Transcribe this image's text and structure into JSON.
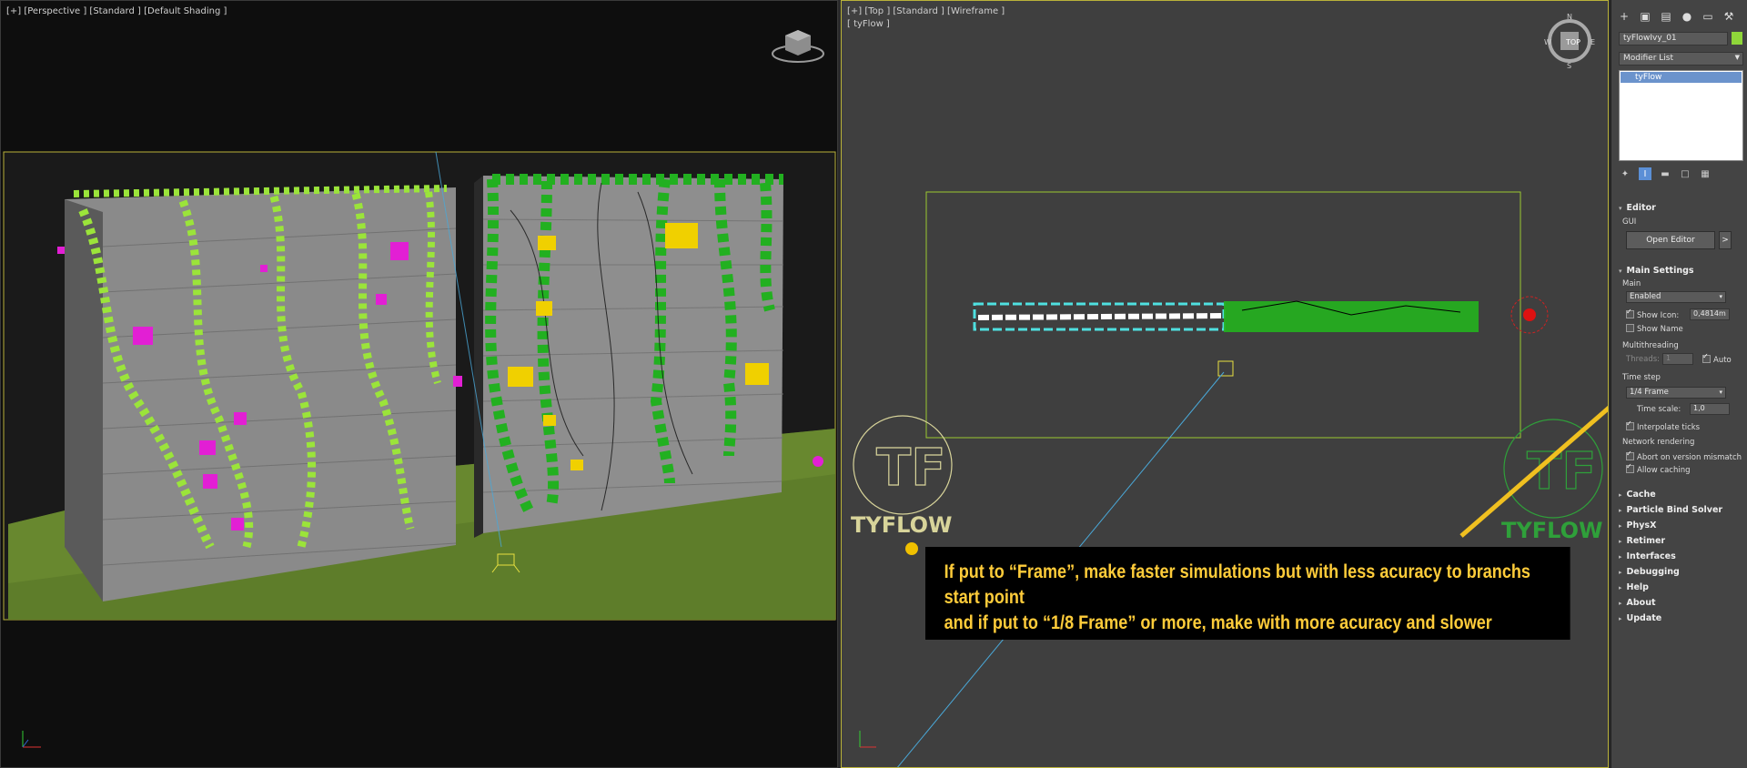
{
  "viewports": {
    "left": {
      "label": "[+] [Perspective ] [Standard ] [Default Shading ]"
    },
    "right": {
      "label": "[+] [Top ] [Standard ] [Wireframe ]",
      "sublabel": "[ tyFlow ]"
    }
  },
  "logo": {
    "text": "TYFLOW",
    "mark": "TF"
  },
  "viewcube": {
    "north": "N",
    "south": "S",
    "east": "E",
    "west": "W"
  },
  "annotation": {
    "line1": "If put to  “Frame”, make faster simulations but with less acuracy to branchs start point",
    "line2": "and if put to “1/8 Frame” or more, make with more acuracy and slower"
  },
  "colors": {
    "accent": "#a6d23a",
    "highlight": "#ffcc3a",
    "selection": "#6b93cc"
  },
  "panel": {
    "toolbar_icons": [
      "create-icon",
      "modify-icon",
      "hierarchy-icon",
      "motion-icon",
      "display-icon",
      "utilities-icon"
    ],
    "object_name": "tyFlowIvy_01",
    "modifier_list": "Modifier List",
    "stack_item": "tyFlow",
    "editor": {
      "title": "Editor",
      "gui": "GUI",
      "open_editor": "Open Editor",
      "arrow": ">"
    },
    "main_settings": {
      "title": "Main Settings",
      "main": "Main",
      "enabled": "Enabled",
      "show_icon": "Show Icon:",
      "icon_size": "0,4814m",
      "show_name": "Show Name",
      "multithreading": "Multithreading",
      "threads": "Threads:",
      "threads_value": "1",
      "auto": "Auto",
      "time_step": "Time step",
      "time_step_value": "1/4 Frame",
      "time_scale": "Time scale:",
      "time_scale_value": "1,0",
      "interpolate": "Interpolate ticks",
      "network": "Network rendering",
      "abort": "Abort on version mismatch",
      "allow_caching": "Allow caching"
    },
    "rollouts": [
      "Cache",
      "Particle Bind Solver",
      "PhysX",
      "Retimer",
      "Interfaces",
      "Debugging",
      "Help",
      "About",
      "Update"
    ]
  }
}
